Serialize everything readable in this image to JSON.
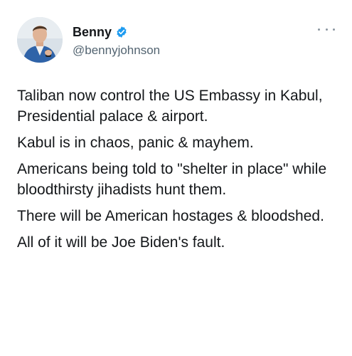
{
  "user": {
    "display_name": "Benny",
    "handle": "@bennyjohnson",
    "verified": true,
    "verified_color": "#1d9bf0"
  },
  "more_menu_icon": "more-horizontal-icon",
  "tweet": {
    "paragraphs": [
      "Taliban now control the US Embassy in Kabul, Presidential palace & airport.",
      "Kabul is in chaos, panic & mayhem.",
      "Americans being told to \"shelter in place\" while bloodthirsty jihadists hunt them.",
      "There will be American hostages & bloodshed.",
      "All of it will be Joe Biden's fault."
    ]
  }
}
